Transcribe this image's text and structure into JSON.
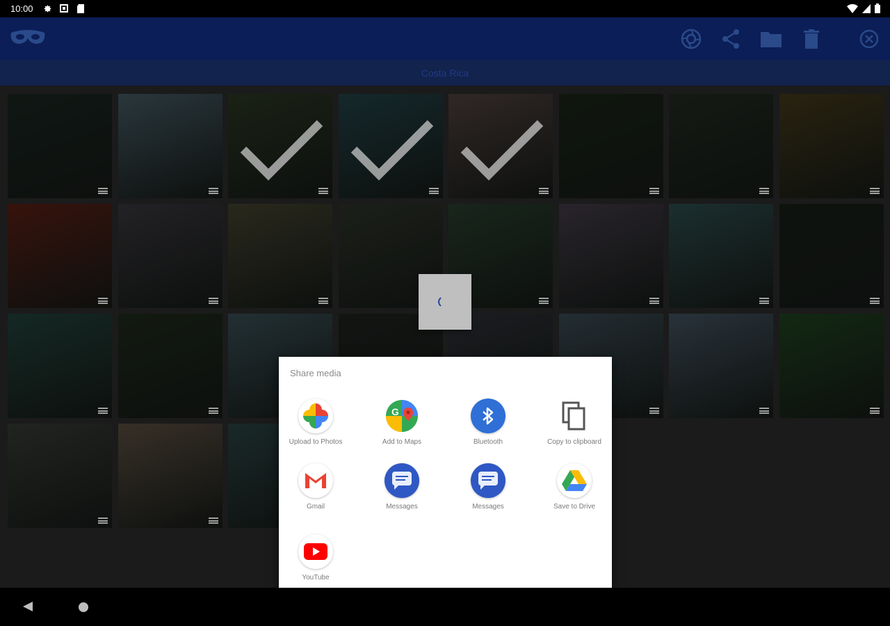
{
  "status_bar": {
    "time": "10:00",
    "icons": [
      "gear-icon",
      "square-icon",
      "sdcard-icon"
    ],
    "right_icons": [
      "wifi-icon",
      "signal-icon",
      "battery-icon"
    ]
  },
  "toolbar": {
    "app_icon": "mask-icon",
    "actions": [
      "aperture-icon",
      "share-icon",
      "folder-icon",
      "trash-icon",
      "close-circle-icon"
    ],
    "background_color": "#0c1e57"
  },
  "album": {
    "title": "Costa Rica"
  },
  "share_dialog": {
    "title": "Share media",
    "apps": [
      {
        "label": "Upload to Photos",
        "icon": "google-photos-icon"
      },
      {
        "label": "Add to Maps",
        "icon": "google-maps-icon"
      },
      {
        "label": "Bluetooth",
        "icon": "bluetooth-icon"
      },
      {
        "label": "Copy to clipboard",
        "icon": "copy-icon"
      },
      {
        "label": "Gmail",
        "icon": "gmail-icon"
      },
      {
        "label": "Messages",
        "icon": "messages-icon"
      },
      {
        "label": "Messages",
        "icon": "messages-icon"
      },
      {
        "label": "Save to Drive",
        "icon": "google-drive-icon"
      },
      {
        "label": "YouTube",
        "icon": "youtube-icon"
      }
    ]
  },
  "grid": {
    "selected_tiles": [
      2,
      3,
      4
    ],
    "tiles": [
      {
        "subject": "waterfall",
        "color": "#24342c"
      },
      {
        "subject": "surfer",
        "color": "#5d7a86"
      },
      {
        "subject": "jungle",
        "color": "#3b4a30"
      },
      {
        "subject": "coastline aerial",
        "color": "#2f5a60"
      },
      {
        "subject": "sunset",
        "color": "#6a5854"
      },
      {
        "subject": "toucan",
        "color": "#243320"
      },
      {
        "subject": "forest",
        "color": "#2e3a2c"
      },
      {
        "subject": "palm fruit",
        "color": "#5b4d24"
      },
      {
        "subject": "frog on heliconia",
        "color": "#7a2a1c"
      },
      {
        "subject": "dusk sea",
        "color": "#4d4a52"
      },
      {
        "subject": "macaw",
        "color": "#5b5a40"
      },
      {
        "subject": "toucan branch",
        "color": "#3e4638"
      },
      {
        "subject": "lagoon",
        "color": "#36543e"
      },
      {
        "subject": "sailboat",
        "color": "#5a5060"
      },
      {
        "subject": "peninsula",
        "color": "#3e6868"
      },
      {
        "subject": "jungle dark",
        "color": "#1f2a1f"
      },
      {
        "subject": "beach aerial",
        "color": "#2f5a50"
      },
      {
        "subject": "forest trees",
        "color": "#2a3a26"
      },
      {
        "subject": "beach trees",
        "color": "#4d6a72"
      },
      {
        "subject": "dark",
        "color": "#2a2f2a"
      },
      {
        "subject": "volcano",
        "color": "#3c4048"
      },
      {
        "subject": "coast hills",
        "color": "#4f6470"
      },
      {
        "subject": "woman on beach",
        "color": "#5a7080"
      },
      {
        "subject": "tree frog",
        "color": "#2a5a2a"
      },
      {
        "subject": "couple",
        "color": "#4a5048"
      },
      {
        "subject": "surfboards",
        "color": "#7a6a58"
      },
      {
        "subject": "rocks sea",
        "color": "#3a5a5a"
      }
    ]
  },
  "navbar": {
    "icons": [
      "back-icon",
      "home-icon"
    ]
  }
}
